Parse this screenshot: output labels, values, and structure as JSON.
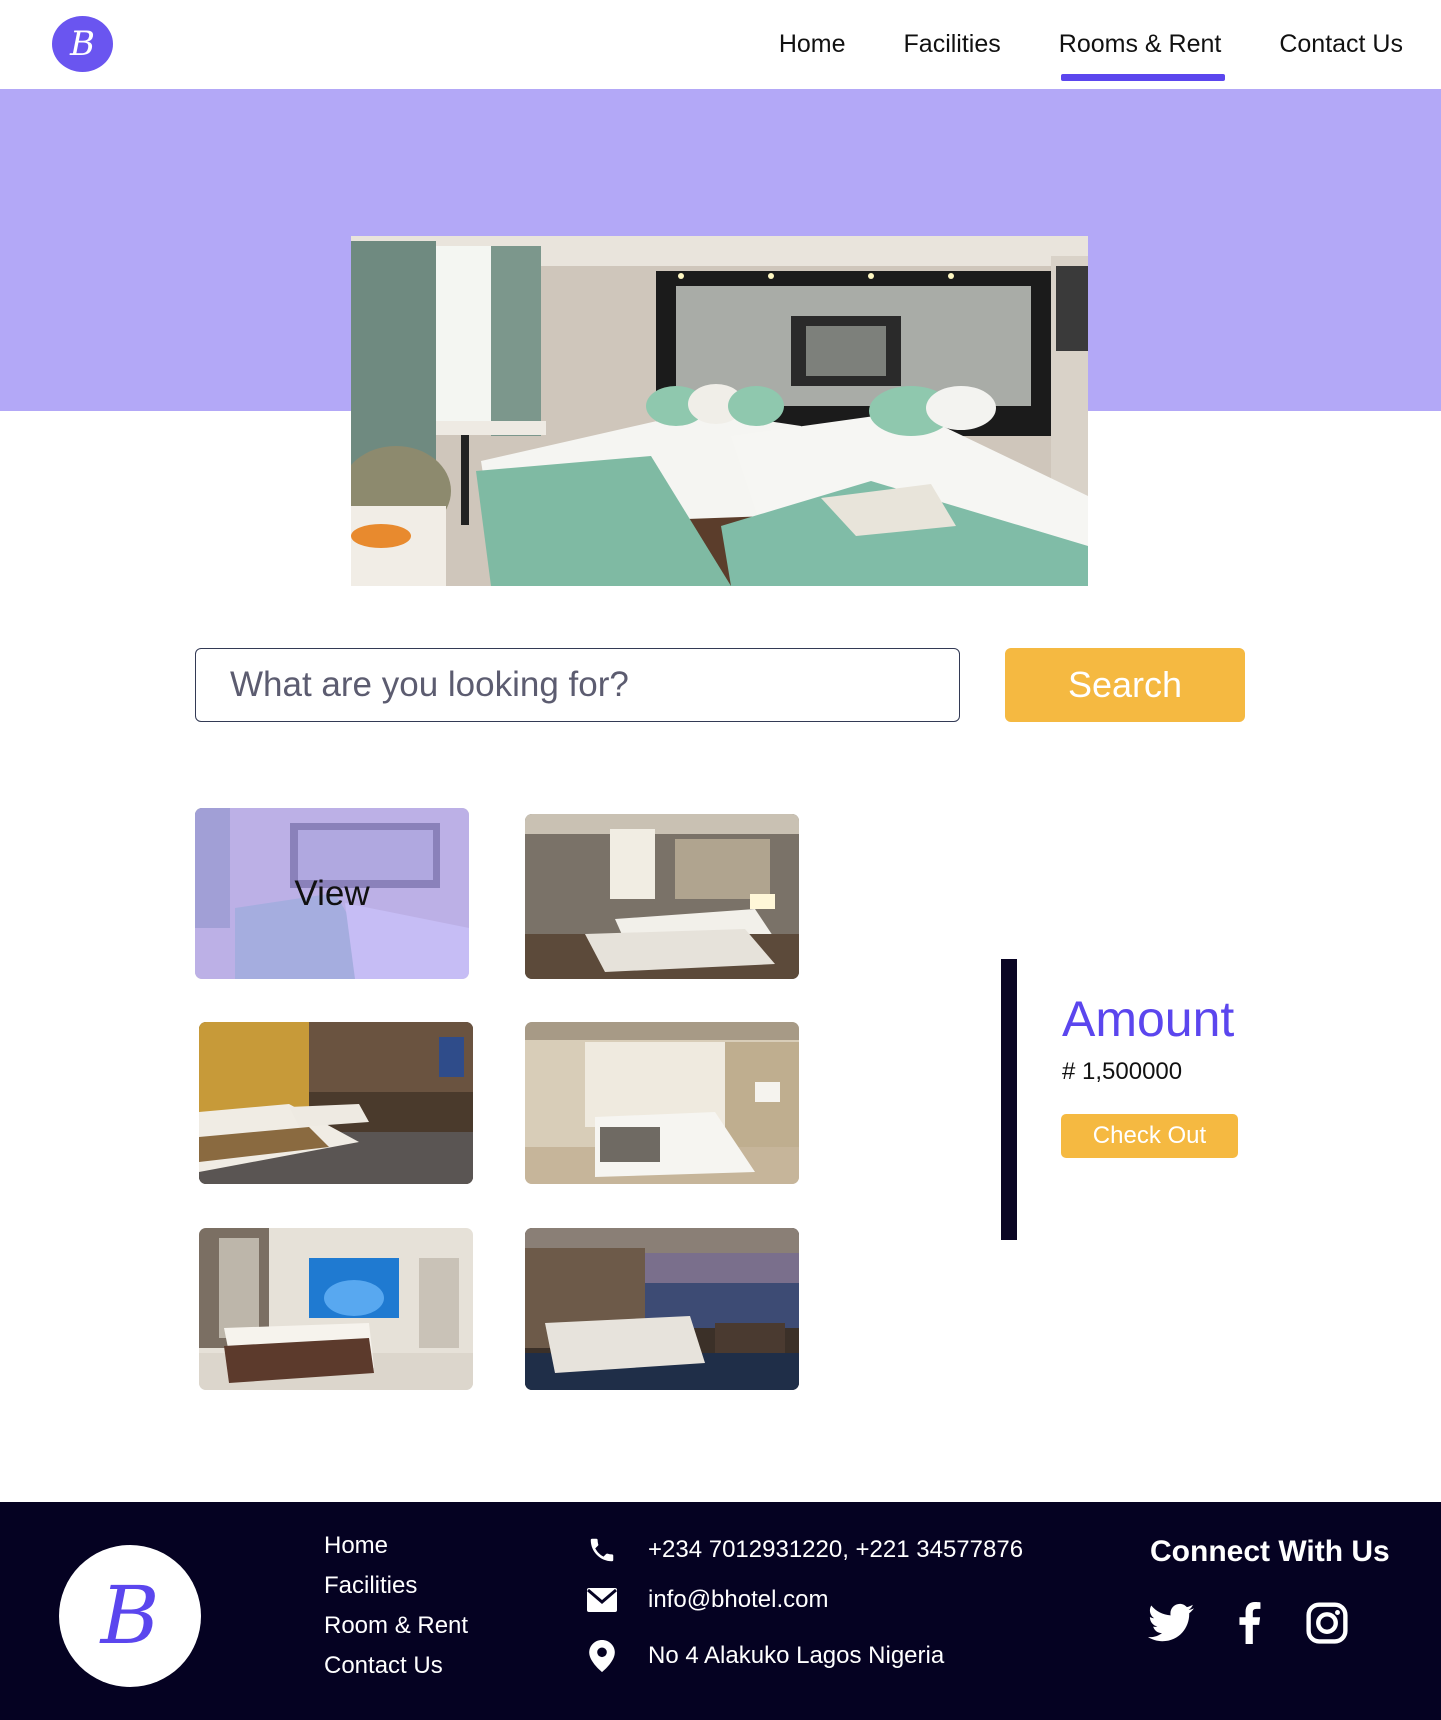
{
  "brand": {
    "logo_letter": "B"
  },
  "nav": {
    "items": [
      {
        "label": "Home"
      },
      {
        "label": "Facilities"
      },
      {
        "label": "Rooms & Rent"
      },
      {
        "label": "Contact Us"
      }
    ],
    "active": "Rooms & Rent"
  },
  "search": {
    "placeholder": "What are you looking for?",
    "button_label": "Search"
  },
  "gallery": {
    "overlay_label": "View"
  },
  "amount": {
    "title": "Amount",
    "value": "# 1,500000",
    "checkout_label": "Check Out"
  },
  "footer": {
    "logo_letter": "B",
    "links": [
      "Home",
      "Facilities",
      "Room & Rent",
      "Contact Us"
    ],
    "phone": "+234 7012931220, +221 34577876",
    "email": "info@bhotel.com",
    "address": "No 4 Alakuko Lagos Nigeria",
    "connect_title": "Connect With Us",
    "social_icons": [
      "twitter-icon",
      "facebook-icon",
      "instagram-icon"
    ]
  },
  "colors": {
    "accent": "#5b46ee",
    "hero_band": "#b3a8f7",
    "button": "#f5b941",
    "footer_bg": "#050222"
  }
}
